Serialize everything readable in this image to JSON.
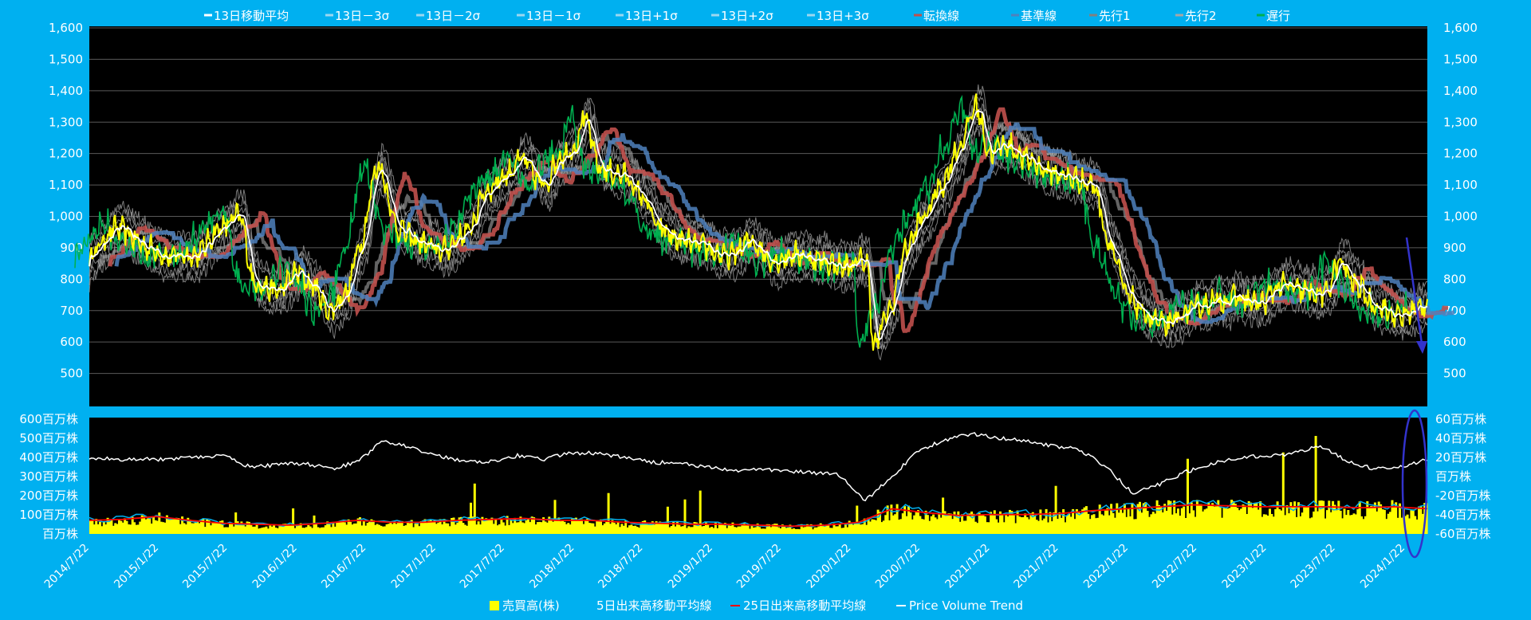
{
  "colors": {
    "background": "#00b0f0",
    "plot_bg": "#000000",
    "sma": "#ffffff",
    "band": "#a6a6a6",
    "tenkan": "#c0504d",
    "kijun": "#4f81bd",
    "senkou1": "#808080",
    "senkou2": "#a6a6a6",
    "chikou": "#00b050",
    "price": "#ffff00",
    "volume": "#ffff00",
    "vol_ma5": "#00b0f0",
    "vol_ma25": "#ff0000",
    "pvt": "#ffffff",
    "annotation": "#3333cc"
  },
  "chart_data": [
    {
      "type": "line",
      "legend": [
        "13日移動平均",
        "13日－3σ",
        "13日－2σ",
        "13日－1σ",
        "13日+1σ",
        "13日+2σ",
        "13日+3σ",
        "転換線",
        "基準線",
        "先行1",
        "先行2",
        "遅行"
      ],
      "legend_placement": "top",
      "y_ticks": [
        "1,600",
        "1,500",
        "1,400",
        "1,300",
        "1,200",
        "1,100",
        "1,000",
        "900",
        "800",
        "700",
        "600",
        "500"
      ],
      "ylim": [
        400,
        1600
      ],
      "grid": true,
      "price_path": {
        "x": [
          "2014/7/22",
          "2014/10/1",
          "2015/1/1",
          "2015/2/15",
          "2015/5/1",
          "2015/7/1",
          "2015/8/22",
          "2015/10/1",
          "2015/12/1",
          "2016/1/22",
          "2016/3/1",
          "2016/4/15",
          "2016/6/1",
          "2016/7/1",
          "2016/8/22",
          "2016/10/15",
          "2016/12/1",
          "2017/2/1",
          "2017/4/15",
          "2017/6/1",
          "2017/7/22",
          "2017/9/1",
          "2017/11/1",
          "2017/12/15",
          "2018/1/22",
          "2018/2/15",
          "2018/4/1",
          "2018/6/1",
          "2018/7/22",
          "2018/9/1",
          "2018/11/1",
          "2019/1/1",
          "2019/3/1",
          "2019/5/1",
          "2019/7/1",
          "2019/9/1",
          "2019/11/1",
          "2020/1/1",
          "2020/3/1",
          "2020/3/22",
          "2020/5/1",
          "2020/6/15",
          "2020/8/1",
          "2020/9/15",
          "2020/11/1",
          "2020/12/15",
          "2021/1/22",
          "2021/3/1",
          "2021/5/1",
          "2021/7/1",
          "2021/9/1",
          "2021/10/22",
          "2021/12/1",
          "2022/1/22",
          "2022/3/15",
          "2022/5/1",
          "2022/7/1",
          "2022/9/1",
          "2022/11/1",
          "2023/1/1",
          "2023/3/1",
          "2023/5/1",
          "2023/6/22",
          "2023/8/1",
          "2023/9/15",
          "2023/11/1",
          "2024/1/1",
          "2024/2/15",
          "2024/3/15"
        ],
        "y": [
          880,
          960,
          900,
          870,
          880,
          960,
          1000,
          790,
          760,
          820,
          780,
          700,
          760,
          900,
          1160,
          960,
          920,
          890,
          950,
          1080,
          1130,
          1180,
          1100,
          1190,
          1220,
          1310,
          1150,
          1130,
          1060,
          960,
          920,
          900,
          870,
          920,
          860,
          880,
          860,
          840,
          860,
          590,
          700,
          900,
          1000,
          1100,
          1220,
          1350,
          1200,
          1230,
          1180,
          1140,
          1120,
          1100,
          920,
          740,
          680,
          650,
          700,
          730,
          740,
          720,
          780,
          760,
          750,
          850,
          780,
          720,
          680,
          700,
          720
        ]
      }
    },
    {
      "type": "bar",
      "legend": [
        "売買高(株)",
        "5日出来高移動平均線",
        "25日出来高移動平均線",
        "Price Volume Trend"
      ],
      "legend_placement": "bottom",
      "y_left_ticks": [
        "600百万株",
        "500百万株",
        "400百万株",
        "300百万株",
        "200百万株",
        "100百万株",
        "百万株"
      ],
      "y_right_ticks": [
        "60百万株",
        "40百万株",
        "20百万株",
        "百万株",
        "-20百万株",
        "-40百万株",
        "-60百万株"
      ],
      "y_left_range": [
        0,
        600
      ],
      "y_right_range": [
        -60,
        60
      ],
      "x_ticks": [
        "2014/7/22",
        "2015/1/22",
        "2015/7/22",
        "2016/1/22",
        "2016/7/22",
        "2017/1/22",
        "2017/7/22",
        "2018/1/22",
        "2018/7/22",
        "2019/1/22",
        "2019/7/22",
        "2020/1/22",
        "2020/7/22",
        "2021/1/22",
        "2021/7/22",
        "2022/1/22",
        "2022/7/22",
        "2023/1/22",
        "2023/7/22",
        "2024/1/22"
      ],
      "volume_ma25_millions": [
        70,
        75,
        90,
        70,
        55,
        50,
        45,
        55,
        70,
        60,
        60,
        70,
        75,
        80,
        70,
        70,
        60,
        55,
        50,
        50,
        45,
        40,
        45,
        60,
        130,
        110,
        95,
        100,
        100,
        105,
        120,
        130,
        140,
        150,
        145,
        140,
        140,
        140,
        135,
        140,
        130
      ],
      "pvt_millions": [
        20,
        18,
        18,
        18,
        20,
        22,
        10,
        12,
        14,
        8,
        15,
        38,
        30,
        22,
        16,
        16,
        22,
        18,
        25,
        24,
        20,
        15,
        14,
        10,
        6,
        8,
        6,
        4,
        2,
        -25,
        0,
        28,
        38,
        45,
        40,
        38,
        32,
        28,
        10,
        -18,
        -8,
        5,
        14,
        20,
        22,
        24,
        32,
        16,
        8,
        10,
        18
      ]
    }
  ]
}
